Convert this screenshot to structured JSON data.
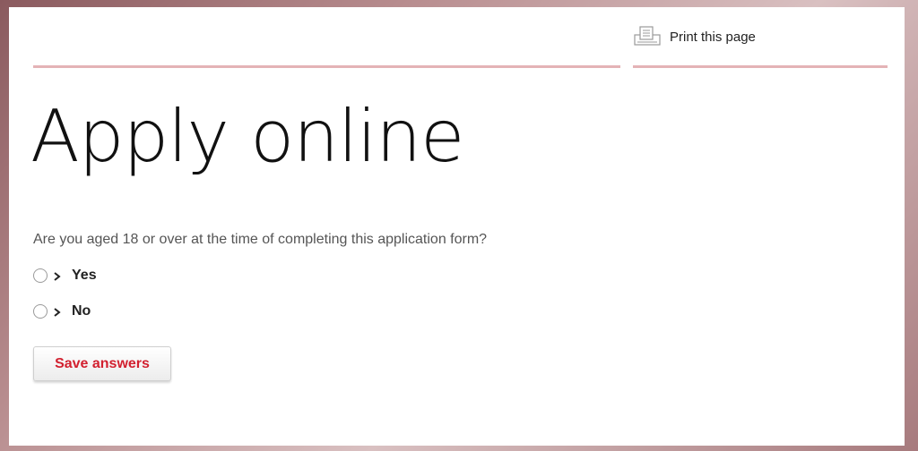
{
  "header": {
    "print_label": "Print this page",
    "print_icon": "printer-icon"
  },
  "main": {
    "title": "Apply online",
    "question": "Are you aged 18 or over at the time of completing this application form?",
    "options": [
      {
        "label": "Yes",
        "selected": false
      },
      {
        "label": "No",
        "selected": false
      }
    ],
    "save_label": "Save answers"
  },
  "colors": {
    "rule": "#e4b3b6",
    "save_text": "#d2202f"
  }
}
